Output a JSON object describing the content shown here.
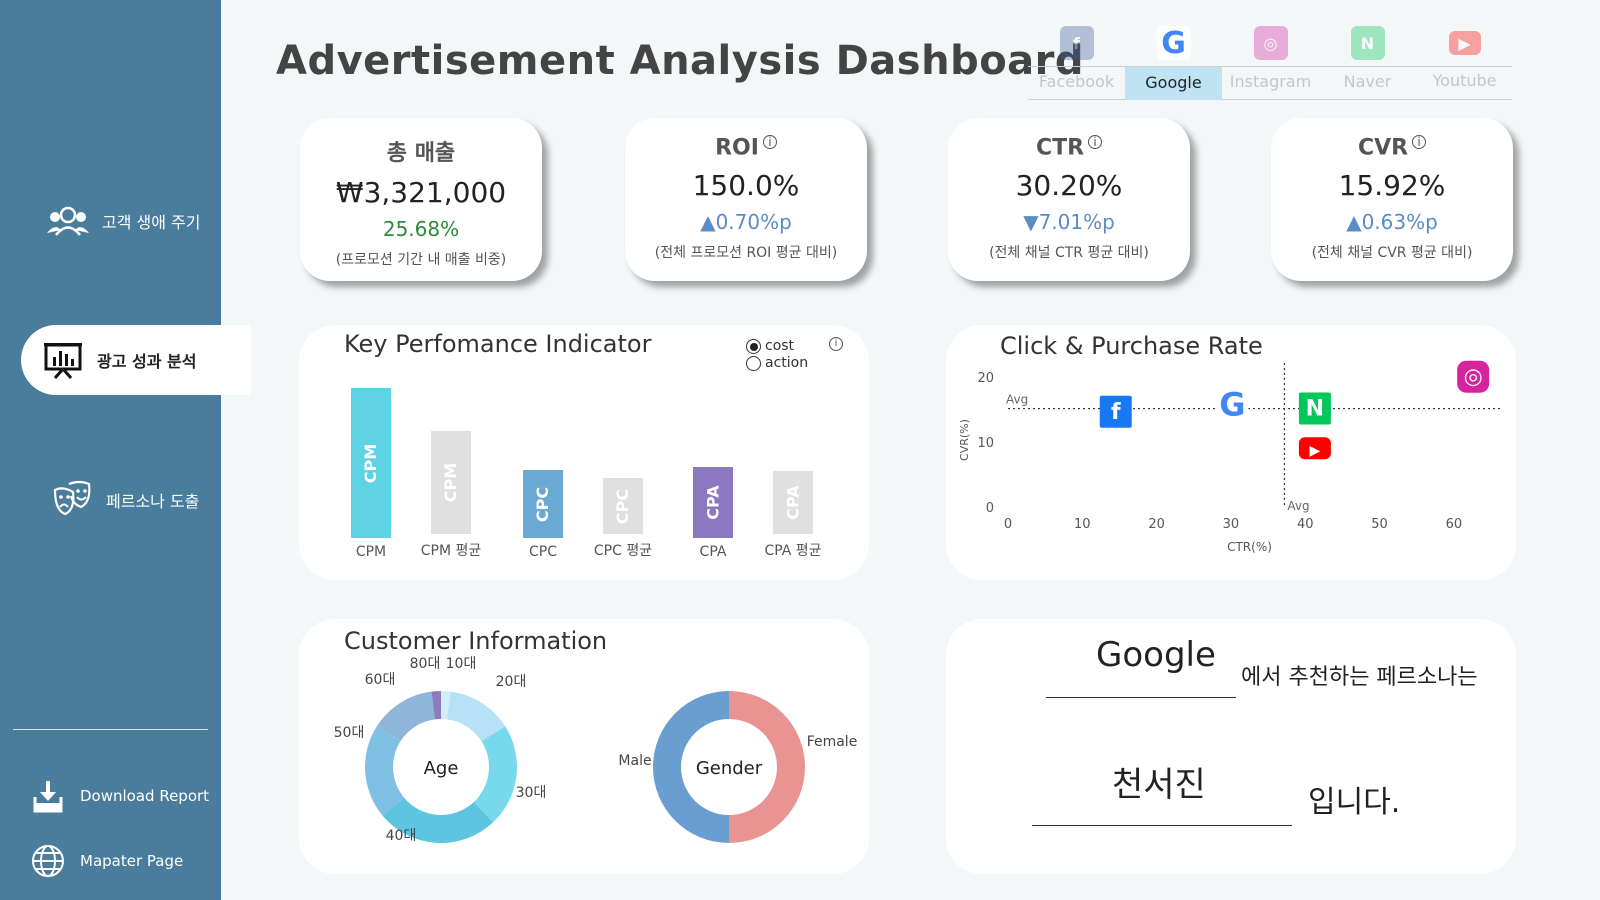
{
  "sidebar": {
    "items": [
      {
        "label": "고객 생애 주기",
        "icon": "customers-icon"
      },
      {
        "label": "광고 성과 분석",
        "icon": "presentation-chart-icon"
      },
      {
        "label": "페르소나 도출",
        "icon": "theater-masks-icon"
      }
    ],
    "footer": [
      {
        "label": "Download Report",
        "icon": "download-icon"
      },
      {
        "label": "Mapater Page",
        "icon": "globe-icon"
      }
    ]
  },
  "header": {
    "title": "Advertisement Analysis Dashboard"
  },
  "channels": {
    "selected": "Google",
    "tabs": [
      {
        "label": "Facebook",
        "icon_text": "f",
        "color": "#3b5998"
      },
      {
        "label": "Google",
        "icon_text": "G",
        "color": "#4285f4"
      },
      {
        "label": "Instagram",
        "icon_text": "◎",
        "color": "#d6249f"
      },
      {
        "label": "Naver",
        "icon_text": "N",
        "color": "#03c75a"
      },
      {
        "label": "Youtube",
        "icon_text": "▶",
        "color": "#ff0000"
      }
    ]
  },
  "kpis": [
    {
      "title": "총 매출",
      "value": "₩3,321,000",
      "delta": "25.68%",
      "note": "(프로모션 기간 내 매출 비중)"
    },
    {
      "title": "ROI",
      "info": "i",
      "value": "150.0%",
      "delta": "▲0.70%p",
      "note": "(전체 프로모션 ROI 평균 대비)"
    },
    {
      "title": "CTR",
      "info": "i",
      "value": "30.20%",
      "delta": "▼7.01%p",
      "note": "(전체 채널 CTR 평균 대비)"
    },
    {
      "title": "CVR",
      "info": "i",
      "value": "15.92%",
      "delta": "▲0.63%p",
      "note": "(전체 채널 CVR 평균 대비)"
    }
  ],
  "kpi_panel": {
    "title": "Key Perfomance Indicator",
    "radio": [
      "cost",
      "action"
    ],
    "radio_selected": "cost",
    "info": "i"
  },
  "scatter_panel": {
    "title": "Click & Purchase Rate"
  },
  "customer_panel": {
    "title": "Customer Information"
  },
  "persona": {
    "channel": "Google",
    "suffix1": "에서 추천하는 페르소나는",
    "name": "천서진",
    "suffix2": "입니다."
  },
  "chart_data": [
    {
      "type": "bar",
      "categories": [
        "CPM",
        "CPM 평균",
        "CPC",
        "CPC 평균",
        "CPA",
        "CPA 평균"
      ],
      "bar_labels": [
        "CPM",
        "CPM",
        "CPC",
        "CPC",
        "CPA",
        "CPA"
      ],
      "values": [
        1.0,
        0.69,
        0.45,
        0.37,
        0.47,
        0.42
      ],
      "colors": [
        "#5dd3e4",
        "#e0e0e0",
        "#6aa9d4",
        "#e0e0e0",
        "#8a79c0",
        "#e0e0e0"
      ]
    },
    {
      "type": "scatter",
      "xlabel": "CTR(%)",
      "ylabel": "CVR(%)",
      "xlim": [
        0,
        65
      ],
      "ylim": [
        0,
        22
      ],
      "xticks": [
        0,
        10,
        20,
        30,
        40,
        50,
        60
      ],
      "yticks": [
        0,
        10,
        20
      ],
      "avg_label": "Avg",
      "avg_x": 37.2,
      "avg_y": 15.3,
      "points": [
        {
          "name": "Facebook",
          "x": 14.5,
          "y": 14.8,
          "icon": "facebook-icon",
          "color": "#1877f2",
          "text": "f"
        },
        {
          "name": "Google",
          "x": 30.2,
          "y": 15.9,
          "icon": "google-icon",
          "color": "#4285f4",
          "text": "G"
        },
        {
          "name": "Naver",
          "x": 41.3,
          "y": 15.3,
          "icon": "naver-icon",
          "color": "#03c75a",
          "text": "N"
        },
        {
          "name": "Youtube",
          "x": 41.3,
          "y": 9.2,
          "icon": "youtube-icon",
          "color": "#ff0000",
          "text": "▶"
        },
        {
          "name": "Instagram",
          "x": 62.6,
          "y": 20.2,
          "icon": "instagram-icon",
          "color": "#d6249f",
          "text": "◎"
        }
      ]
    },
    {
      "type": "pie",
      "center_label": "Age",
      "categories": [
        "10대",
        "20대",
        "30대",
        "40대",
        "50대",
        "60대",
        "80대"
      ],
      "values": [
        2,
        14,
        22,
        26,
        20,
        14,
        2
      ],
      "colors": [
        "#d3eefb",
        "#b7e2f5",
        "#78d9ee",
        "#5cc6e1",
        "#7ebfe3",
        "#8fb6d8",
        "#8b7bbf"
      ]
    },
    {
      "type": "pie",
      "center_label": "Gender",
      "categories": [
        "Female",
        "Male"
      ],
      "values": [
        50,
        50
      ],
      "colors": [
        "#e99493",
        "#6b9ed0"
      ]
    }
  ]
}
